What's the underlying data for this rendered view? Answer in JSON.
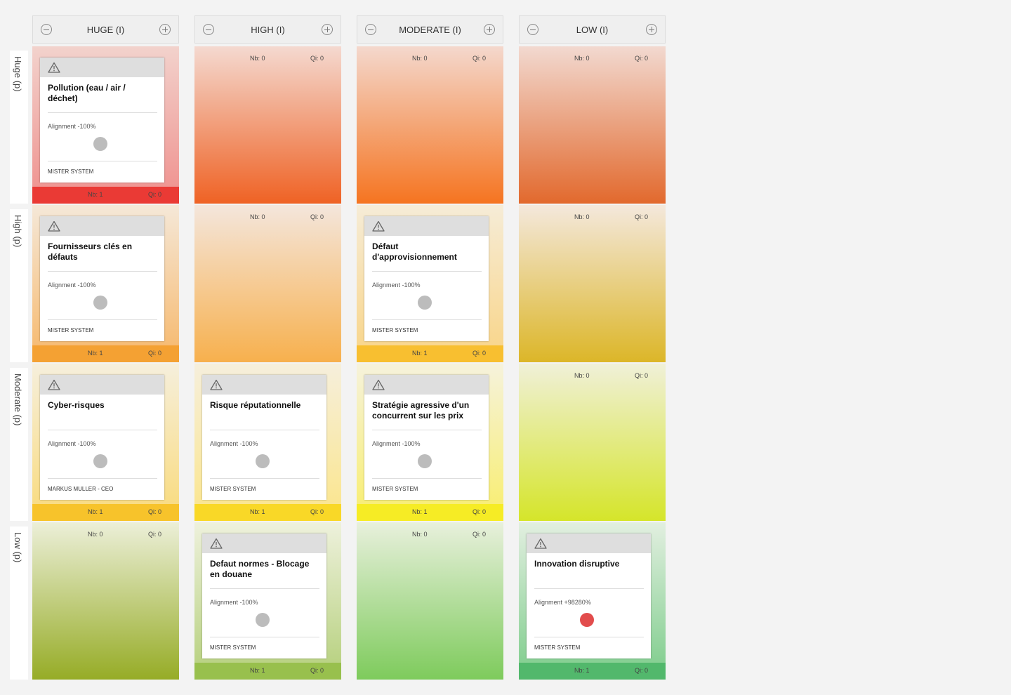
{
  "columns": [
    {
      "title": "HUGE (I)"
    },
    {
      "title": "HIGH (I)"
    },
    {
      "title": "MODERATE (I)"
    },
    {
      "title": "LOW (I)"
    }
  ],
  "rows": [
    {
      "label": "Huge (p)"
    },
    {
      "label": "High (p)"
    },
    {
      "label": "Moderate (p)"
    },
    {
      "label": "Low (p)"
    }
  ],
  "cells": [
    [
      {
        "nb": "Nb: 1",
        "qi": "Qi: 0",
        "card": {
          "title": "Pollution (eau / air / déchet)",
          "alignment": "Alignment -100%",
          "owner": "MISTER SYSTEM",
          "dot": "grey"
        },
        "colors": [
          "#f2d2cc",
          "#ef8f8c"
        ],
        "footer": "#ea3a35"
      },
      {
        "nb": "Nb: 0",
        "qi": "Qi: 0",
        "card": null,
        "colors": [
          "#f4d9d0",
          "#ef6224"
        ]
      },
      {
        "nb": "Nb: 0",
        "qi": "Qi: 0",
        "card": null,
        "colors": [
          "#f4d8cd",
          "#f57420"
        ]
      },
      {
        "nb": "Nb: 0",
        "qi": "Qi: 0",
        "card": null,
        "colors": [
          "#f2d9d0",
          "#e2692d"
        ]
      }
    ],
    [
      {
        "nb": "Nb: 1",
        "qi": "Qi: 0",
        "card": {
          "title": "Fournisseurs clés en défauts",
          "alignment": "Alignment -100%",
          "owner": "MISTER SYSTEM",
          "dot": "grey"
        },
        "colors": [
          "#f5e8d8",
          "#f6b76a"
        ],
        "footer": "#f4a133"
      },
      {
        "nb": "Nb: 0",
        "qi": "Qi: 0",
        "card": null,
        "colors": [
          "#f4e6dc",
          "#f7b04d"
        ]
      },
      {
        "nb": "Nb: 1",
        "qi": "Qi: 0",
        "card": {
          "title": "Défaut d'approvisionnement",
          "alignment": "Alignment -100%",
          "owner": "MISTER SYSTEM",
          "dot": "grey"
        },
        "colors": [
          "#f6ecd7",
          "#f9d486"
        ],
        "footer": "#f8bf30"
      },
      {
        "nb": "Nb: 0",
        "qi": "Qi: 0",
        "card": null,
        "colors": [
          "#f4e8dc",
          "#dcb628"
        ]
      }
    ],
    [
      {
        "nb": "Nb: 1",
        "qi": "Qi: 0",
        "card": {
          "title": "Cyber-risques",
          "alignment": "Alignment -100%",
          "owner": "MARKUS MULLER - CEO",
          "dot": "grey"
        },
        "colors": [
          "#f6efdc",
          "#f9da7a"
        ],
        "footer": "#f7c32b"
      },
      {
        "nb": "Nb: 1",
        "qi": "Qi: 0",
        "card": {
          "title": "Risque réputationnelle",
          "alignment": "Alignment -100%",
          "owner": "MISTER SYSTEM",
          "dot": "grey"
        },
        "colors": [
          "#f6efdc",
          "#fbe58a"
        ],
        "footer": "#f9d827"
      },
      {
        "nb": "Nb: 1",
        "qi": "Qi: 0",
        "card": {
          "title": "Stratégie agressive d'un concurrent sur les prix",
          "alignment": "Alignment -100%",
          "owner": "MISTER SYSTEM",
          "dot": "grey"
        },
        "colors": [
          "#f6f2dc",
          "#f8ee6c"
        ],
        "footer": "#f6ec25"
      },
      {
        "nb": "Nb: 0",
        "qi": "Qi: 0",
        "card": null,
        "colors": [
          "#f0f0d8",
          "#d5e52a"
        ]
      }
    ],
    [
      {
        "nb": "Nb: 0",
        "qi": "Qi: 0",
        "card": null,
        "colors": [
          "#ecefd8",
          "#96ac26"
        ]
      },
      {
        "nb": "Nb: 1",
        "qi": "Qi: 0",
        "card": {
          "title": "Defaut normes - Blocage en douane",
          "alignment": "Alignment -100%",
          "owner": "MISTER SYSTEM",
          "dot": "grey"
        },
        "colors": [
          "#eef1dc",
          "#b4cf7a"
        ],
        "footer": "#98c04d"
      },
      {
        "nb": "Nb: 0",
        "qi": "Qi: 0",
        "card": null,
        "colors": [
          "#e8f0dc",
          "#7ecb5c"
        ]
      },
      {
        "nb": "Nb: 1",
        "qi": "Qi: 0",
        "card": {
          "title": "Innovation disruptive",
          "alignment": "Alignment +98280%",
          "owner": "MISTER SYSTEM",
          "dot": "red"
        },
        "colors": [
          "#e2efe0",
          "#7ccc8a"
        ],
        "footer": "#52b86c"
      }
    ]
  ]
}
